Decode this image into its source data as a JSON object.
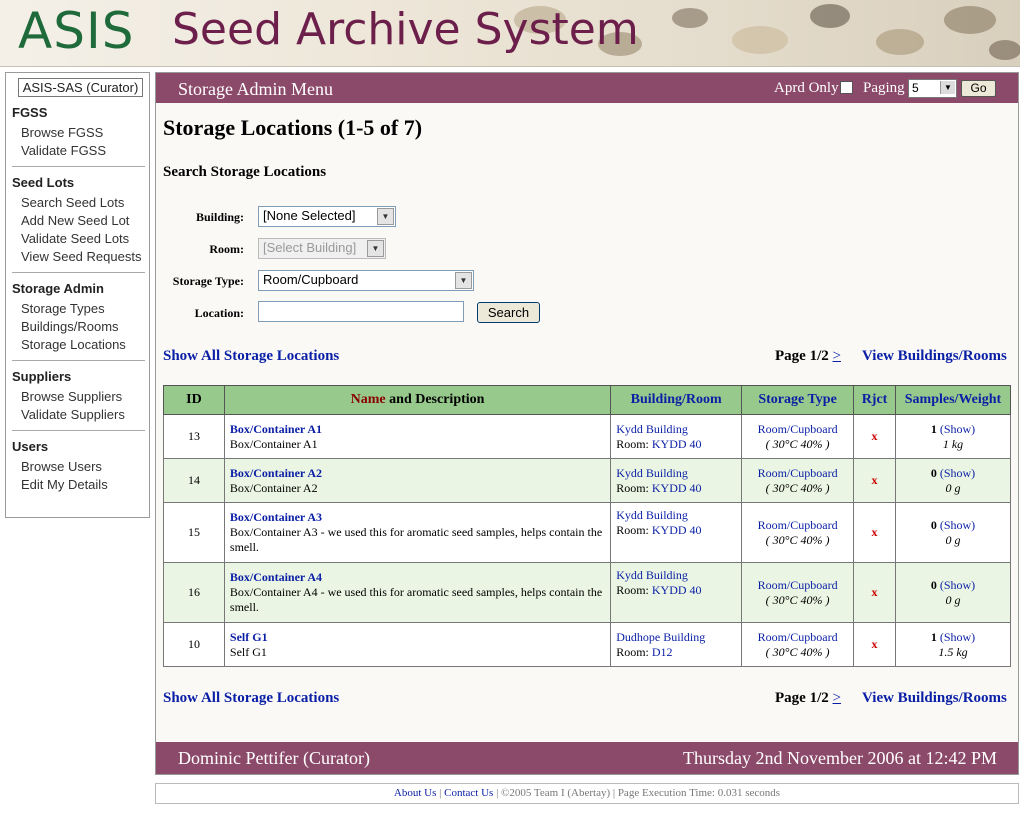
{
  "banner": {
    "asis": "ASIS",
    "title": "Seed Archive System"
  },
  "sidebar": {
    "user": "ASIS-SAS (Curator)",
    "sections": [
      {
        "title": "FGSS",
        "items": [
          "Browse FGSS",
          "Validate FGSS"
        ]
      },
      {
        "title": "Seed Lots",
        "items": [
          "Search Seed Lots",
          "Add New Seed Lot",
          "Validate Seed Lots",
          "View Seed Requests"
        ]
      },
      {
        "title": "Storage Admin",
        "items": [
          "Storage Types",
          "Buildings/Rooms",
          "Storage Locations"
        ]
      },
      {
        "title": "Suppliers",
        "items": [
          "Browse Suppliers",
          "Validate Suppliers"
        ]
      },
      {
        "title": "Users",
        "items": [
          "Browse Users",
          "Edit My Details"
        ]
      }
    ]
  },
  "topbar": {
    "menu_title": "Storage Admin Menu",
    "aprd_label": "Aprd Only",
    "paging_label": "Paging",
    "paging_value": "5",
    "go_label": "Go"
  },
  "page": {
    "title": "Storage Locations (1-5 of 7)",
    "search_heading": "Search Storage Locations"
  },
  "search": {
    "building_label": "Building:",
    "building_value": "[None Selected]",
    "room_label": "Room:",
    "room_value": "[Select Building]",
    "type_label": "Storage Type:",
    "type_value": "Room/Cupboard",
    "location_label": "Location:",
    "location_value": "",
    "search_button": "Search"
  },
  "nav": {
    "show_all": "Show All Storage Locations",
    "page": "Page 1/2",
    "next": ">",
    "view_buildings": "View Buildings/Rooms"
  },
  "table": {
    "headers": {
      "id": "ID",
      "name": "Name",
      "and_desc": " and Description",
      "building": "Building/Room",
      "type": "Storage Type",
      "rjct": "Rjct",
      "samples": "Samples/Weight"
    },
    "rows": [
      {
        "id": "13",
        "name": "Box/Container A1",
        "desc": "Box/Container A1",
        "building": "Kydd Building",
        "room_label": "Room: ",
        "room": "KYDD 40",
        "type": "Room/Cupboard",
        "conditions": "( 30°C  40% )",
        "rjct": "x",
        "count": "1",
        "show": "(Show)",
        "weight": "1 kg"
      },
      {
        "id": "14",
        "name": "Box/Container A2",
        "desc": "Box/Container A2",
        "building": "Kydd Building",
        "room_label": "Room: ",
        "room": "KYDD 40",
        "type": "Room/Cupboard",
        "conditions": "( 30°C  40% )",
        "rjct": "x",
        "count": "0",
        "show": "(Show)",
        "weight": "0 g"
      },
      {
        "id": "15",
        "name": "Box/Container A3",
        "desc": "Box/Container A3 - we used this for aromatic seed samples, helps contain the smell.",
        "building": "Kydd Building",
        "room_label": "Room: ",
        "room": "KYDD 40",
        "type": "Room/Cupboard",
        "conditions": "( 30°C  40% )",
        "rjct": "x",
        "count": "0",
        "show": "(Show)",
        "weight": "0 g"
      },
      {
        "id": "16",
        "name": "Box/Container A4",
        "desc": "Box/Container A4 - we used this for aromatic seed samples, helps contain the smell.",
        "building": "Kydd Building",
        "room_label": "Room: ",
        "room": "KYDD 40",
        "type": "Room/Cupboard",
        "conditions": "( 30°C  40% )",
        "rjct": "x",
        "count": "0",
        "show": "(Show)",
        "weight": "0 g"
      },
      {
        "id": "10",
        "name": "Self G1",
        "desc": "Self G1",
        "building": "Dudhope Building",
        "room_label": "Room: ",
        "room": "D12",
        "type": "Room/Cupboard",
        "conditions": "( 30°C  40% )",
        "rjct": "x",
        "count": "1",
        "show": "(Show)",
        "weight": "1.5 kg"
      }
    ]
  },
  "footer": {
    "user": "Dominic Pettifer (Curator)",
    "datetime": "Thursday 2nd November 2006 at 12:42 PM"
  },
  "copyright": {
    "about": "About Us",
    "sep1": " | ",
    "contact": "Contact Us",
    "rest": " | ©2005 Team I (Abertay) | Page Execution Time: 0.031 seconds"
  }
}
